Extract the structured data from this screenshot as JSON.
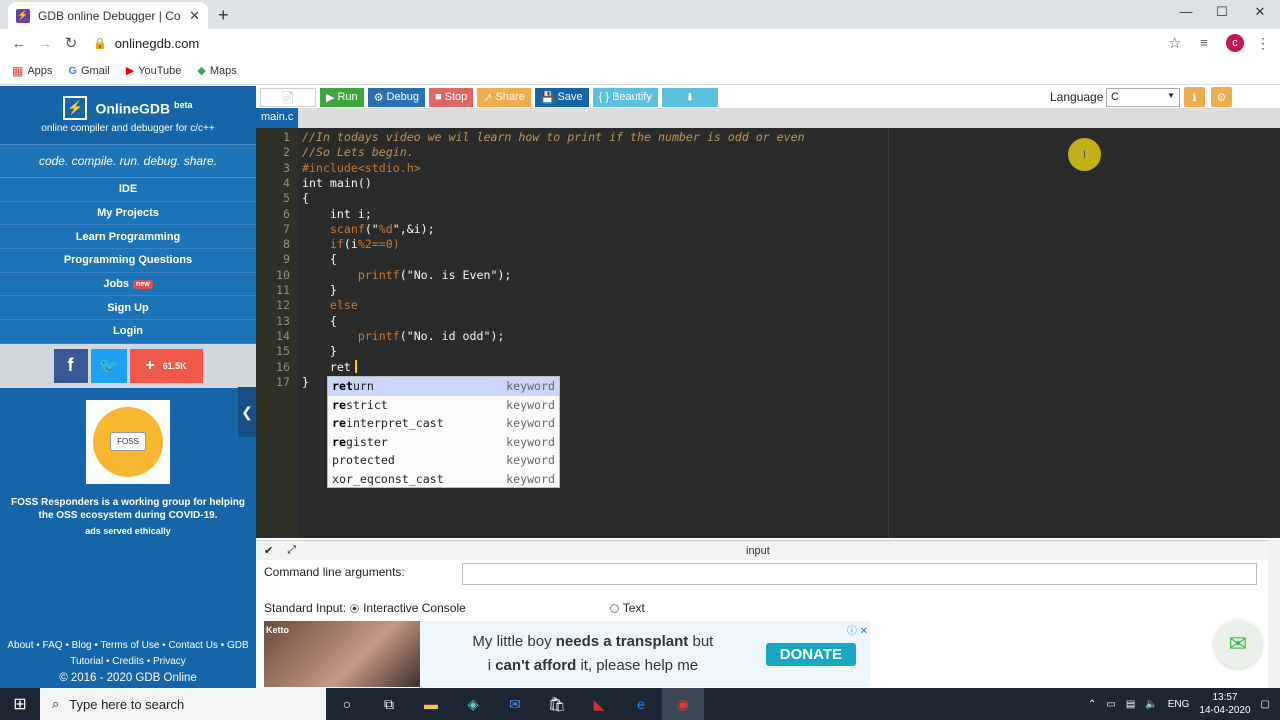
{
  "browser": {
    "tab_title": "GDB online Debugger | Compiler",
    "url": "onlinegdb.com",
    "profile_initial": "c",
    "bookmarks": [
      "Apps",
      "Gmail",
      "YouTube",
      "Maps"
    ]
  },
  "sidebar": {
    "brand": "OnlineGDB",
    "brand_sup": "beta",
    "brand_sub": "online compiler and debugger for c/c++",
    "tagline": "code. compile. run. debug. share.",
    "nav": [
      "IDE",
      "My Projects",
      "Learn Programming",
      "Programming Questions",
      "Jobs",
      "Sign Up",
      "Login"
    ],
    "jobs_badge": "new",
    "share_count": "61.5K",
    "foss_label": "FOSS",
    "foss_text": "FOSS Responders is a working group for helping the OSS ecosystem during COVID-19.",
    "ads_note": "ads served ethically",
    "footer_links_1": "About • FAQ • Blog • Terms of Use • Contact Us • GDB",
    "footer_links_2": "Tutorial • Credits • Privacy",
    "copyright": "© 2016 - 2020 GDB Online"
  },
  "toolbar": {
    "run": "Run",
    "debug": "Debug",
    "stop": "Stop",
    "share": "Share",
    "save": "Save",
    "beautify": "{ } Beautify",
    "language_label": "Language",
    "language_value": "C"
  },
  "editor": {
    "file_tab": "main.c",
    "lines": [
      {
        "n": "1",
        "parts": [
          {
            "t": "//In todays video we wil learn how to print if the number is odd or even",
            "c": "cmt"
          }
        ]
      },
      {
        "n": "2",
        "parts": [
          {
            "t": "//So Lets begin.",
            "c": "cmt"
          }
        ]
      },
      {
        "n": "3",
        "parts": [
          {
            "t": "#include",
            "c": "pre"
          },
          {
            "t": "<stdio.h>",
            "c": "pre"
          }
        ]
      },
      {
        "n": "4",
        "parts": [
          {
            "t": "int main()",
            "c": "pl"
          }
        ]
      },
      {
        "n": "5",
        "parts": [
          {
            "t": "{",
            "c": "pl"
          }
        ]
      },
      {
        "n": "6",
        "parts": [
          {
            "t": "    int i;",
            "c": "pl"
          }
        ]
      },
      {
        "n": "7",
        "parts": [
          {
            "t": "    ",
            "c": "pl"
          },
          {
            "t": "scanf",
            "c": "fn"
          },
          {
            "t": "(\"",
            "c": "pl"
          },
          {
            "t": "%d",
            "c": "ctl"
          },
          {
            "t": "\",&i);",
            "c": "pl"
          }
        ]
      },
      {
        "n": "8",
        "parts": [
          {
            "t": "    ",
            "c": "pl"
          },
          {
            "t": "if",
            "c": "ctl"
          },
          {
            "t": "(i",
            "c": "pl"
          },
          {
            "t": "%",
            "c": "ctl"
          },
          {
            "t": "2==",
            "c": "ctl"
          },
          {
            "t": "0)",
            "c": "ctl"
          }
        ]
      },
      {
        "n": "9",
        "parts": [
          {
            "t": "    {",
            "c": "pl"
          }
        ]
      },
      {
        "n": "10",
        "parts": [
          {
            "t": "        ",
            "c": "pl"
          },
          {
            "t": "printf",
            "c": "fn"
          },
          {
            "t": "(\"No. is Even\");",
            "c": "pl"
          }
        ]
      },
      {
        "n": "11",
        "parts": [
          {
            "t": "    }",
            "c": "pl"
          }
        ]
      },
      {
        "n": "12",
        "parts": [
          {
            "t": "    ",
            "c": "pl"
          },
          {
            "t": "else",
            "c": "ctl"
          }
        ]
      },
      {
        "n": "13",
        "parts": [
          {
            "t": "    {",
            "c": "pl"
          }
        ]
      },
      {
        "n": "14",
        "parts": [
          {
            "t": "        ",
            "c": "pl"
          },
          {
            "t": "printf",
            "c": "fn"
          },
          {
            "t": "(\"No. id odd\");",
            "c": "pl"
          }
        ]
      },
      {
        "n": "15",
        "parts": [
          {
            "t": "    }",
            "c": "pl"
          }
        ]
      },
      {
        "n": "16",
        "parts": [
          {
            "t": "    ret",
            "c": "pl"
          }
        ]
      },
      {
        "n": "17",
        "parts": [
          {
            "t": "}",
            "c": "pl"
          }
        ]
      }
    ],
    "autocomplete": [
      {
        "match": "ret",
        "rest": "urn",
        "meta": "keyword"
      },
      {
        "match": "re",
        "rest": "strict",
        "meta": "keyword",
        "mid": "s",
        "tail": "trict"
      },
      {
        "match": "re",
        "rest": "interpret_cast",
        "meta": "keyword"
      },
      {
        "match": "re",
        "rest": "gister",
        "meta": "keyword"
      },
      {
        "match": "",
        "rest": "protected",
        "meta": "keyword"
      },
      {
        "match": "",
        "rest": "xor_eqconst_cast",
        "meta": "keyword"
      }
    ]
  },
  "io": {
    "title": "input",
    "cmd_label": "Command line arguments:",
    "stdin_label": "Standard Input:",
    "opt_interactive": "Interactive Console",
    "opt_text": "Text"
  },
  "ad": {
    "brand": "Ketto",
    "line1_pre": "My little boy ",
    "line1_bold": "needs a transplant",
    "line1_post": " but",
    "line2_pre": "i ",
    "line2_bold": "can't afford",
    "line2_post": " it, please help me",
    "cta": "DONATE"
  },
  "taskbar": {
    "search_placeholder": "Type here to search",
    "lang": "ENG",
    "time": "13:57",
    "date": "14-04-2020"
  }
}
